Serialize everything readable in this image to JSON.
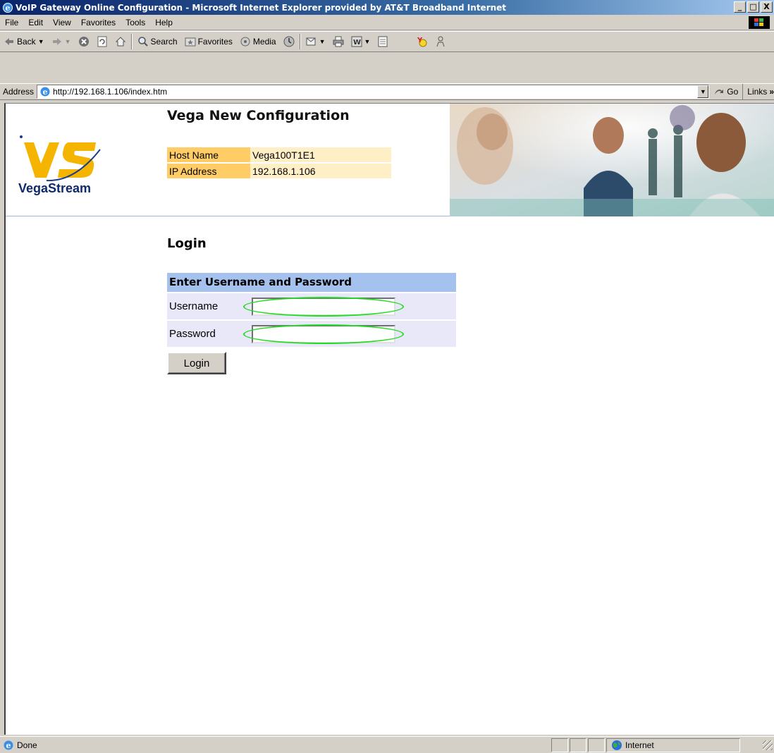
{
  "window": {
    "title": "VoIP Gateway Online Configuration - Microsoft Internet Explorer provided by AT&T Broadband Internet",
    "minimize": "_",
    "maximize": "□",
    "close": "X"
  },
  "menu": [
    "File",
    "Edit",
    "View",
    "Favorites",
    "Tools",
    "Help"
  ],
  "toolbar": {
    "back_label": "Back",
    "search_label": "Search",
    "favorites_label": "Favorites",
    "media_label": "Media"
  },
  "address": {
    "label": "Address",
    "url": "http://192.168.1.106/index.htm",
    "go_label": "Go",
    "links_label": "Links"
  },
  "page": {
    "logo_text": "VegaStream",
    "heading": "Vega New Configuration",
    "info": [
      {
        "key": "Host Name",
        "value": "Vega100T1E1"
      },
      {
        "key": "IP Address",
        "value": "192.168.1.106"
      }
    ],
    "login_title": "Login",
    "panel_title": "Enter Username and Password",
    "username_label": "Username",
    "password_label": "Password",
    "username_value": "",
    "password_value": "",
    "login_button": "Login"
  },
  "status": {
    "text": "Done",
    "zone": "Internet"
  },
  "colors": {
    "titlebar": "#0a246a",
    "info_key_bg": "#ffcc66",
    "info_value_bg": "#ffefc6",
    "panel_head_bg": "#a5c2ef",
    "panel_row_bg": "#e8e8f8",
    "highlight": "#22dd22"
  }
}
